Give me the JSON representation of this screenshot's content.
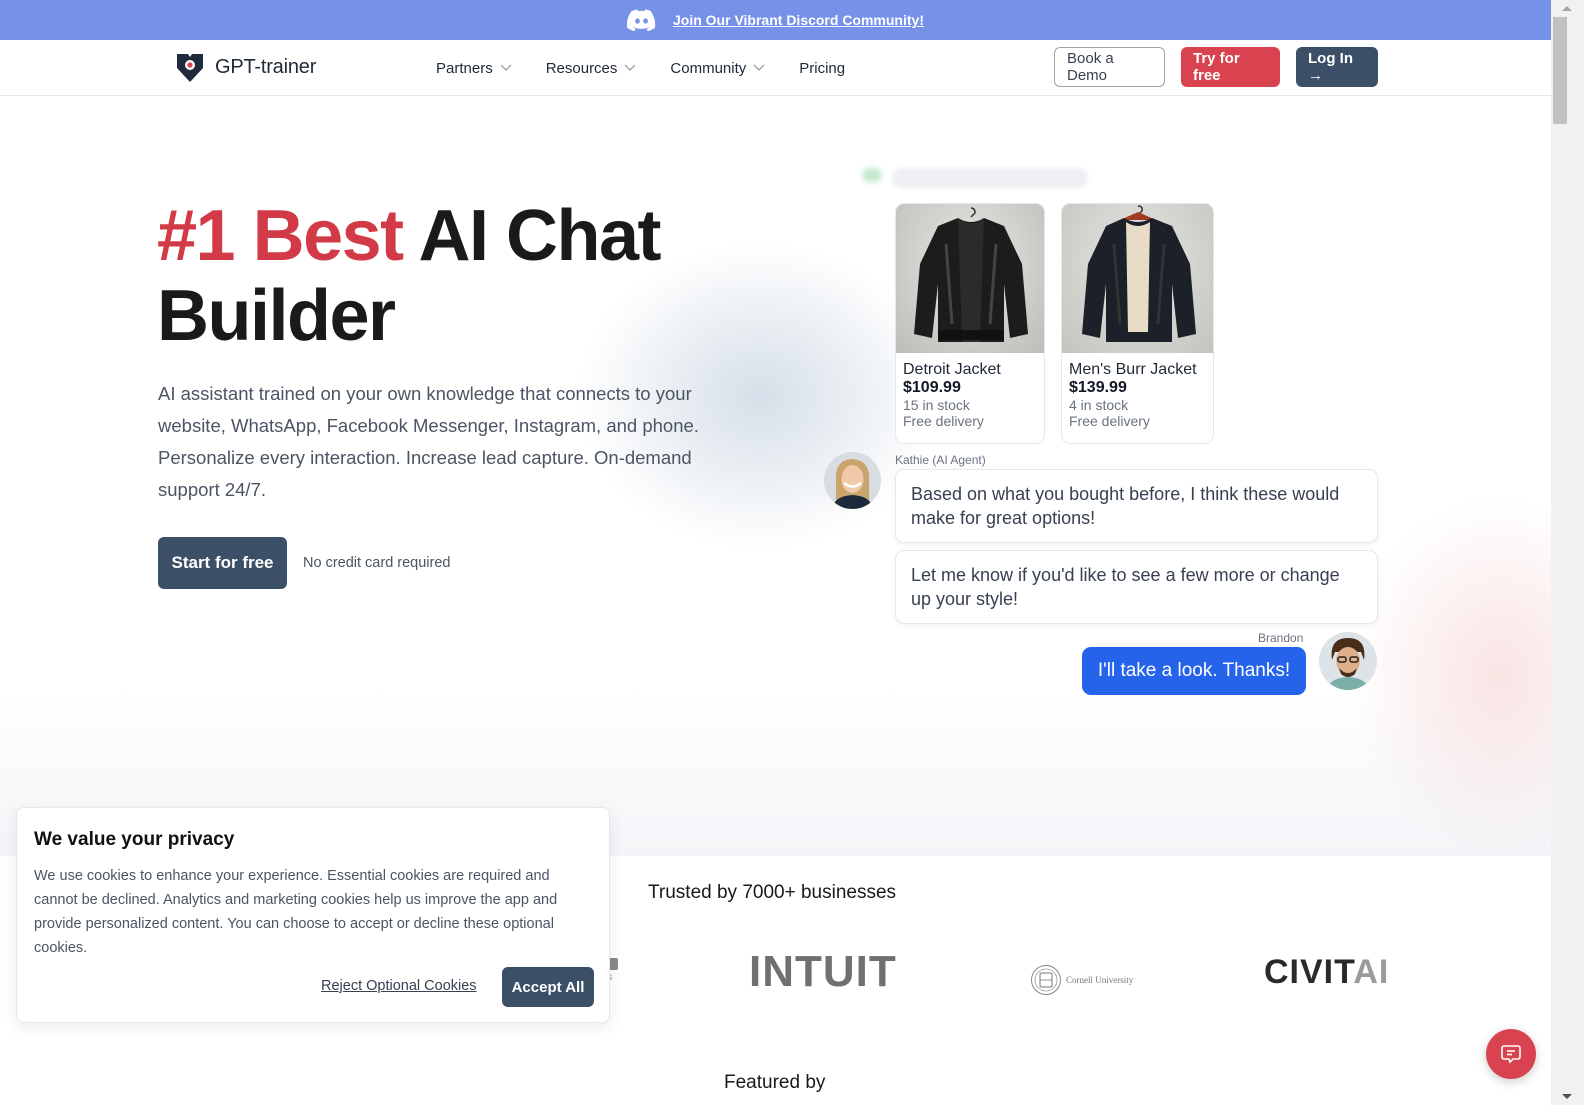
{
  "announcement": {
    "icon": "discord-icon",
    "link_text": "Join Our Vibrant Discord Community!"
  },
  "nav": {
    "logo_text": "GPT-trainer",
    "items": [
      {
        "label": "Partners",
        "has_dropdown": true
      },
      {
        "label": "Resources",
        "has_dropdown": true
      },
      {
        "label": "Community",
        "has_dropdown": true
      },
      {
        "label": "Pricing",
        "has_dropdown": false
      }
    ],
    "book_demo": "Book a Demo",
    "try_free": "Try for free",
    "login": "Log In →"
  },
  "hero": {
    "headline_accent": "#1 Best",
    "headline_rest": " AI Chat",
    "headline_line2": "Builder",
    "subcopy": "AI assistant trained on your own knowledge that connects to your website, WhatsApp, Facebook Messenger, Instagram, and phone. Personalize every interaction. Increase lead capture. On-demand support 24/7.",
    "cta": "Start for free",
    "cta_note": "No credit card required"
  },
  "chat_demo": {
    "products": [
      {
        "name": "Detroit Jacket",
        "price": "$109.99",
        "stock": "15 in stock",
        "delivery": "Free delivery"
      },
      {
        "name": "Men's Burr Jacket",
        "price": "$139.99",
        "stock": "4 in stock",
        "delivery": "Free delivery"
      }
    ],
    "agent_name": "Kathie (AI Agent)",
    "agent_messages": [
      "Based on what you bought before, I think these would make for great options!",
      "Let me know if you'd like to see a few more or change up your style!"
    ],
    "user_name": "Brandon",
    "user_message": "I'll take a look. Thanks!"
  },
  "trusted": {
    "title": "Trusted by 7000+ businesses",
    "logos": [
      "INTUIT",
      "Cornell University",
      "CIVITAI"
    ]
  },
  "featured": {
    "title": "Featured by"
  },
  "cookie_banner": {
    "title": "We value your privacy",
    "body": "We use cookies to enhance your experience. Essential cookies are required and cannot be declined. Analytics and marketing cookies help us improve the app and provide personalized content. You can choose to accept or decline these optional cookies.",
    "reject": "Reject Optional Cookies",
    "accept": "Accept All"
  },
  "colors": {
    "announcement_bg": "#7591e8",
    "brand_red": "#d9434f",
    "brand_dark": "#3b4f66",
    "user_bubble": "#2563eb"
  }
}
